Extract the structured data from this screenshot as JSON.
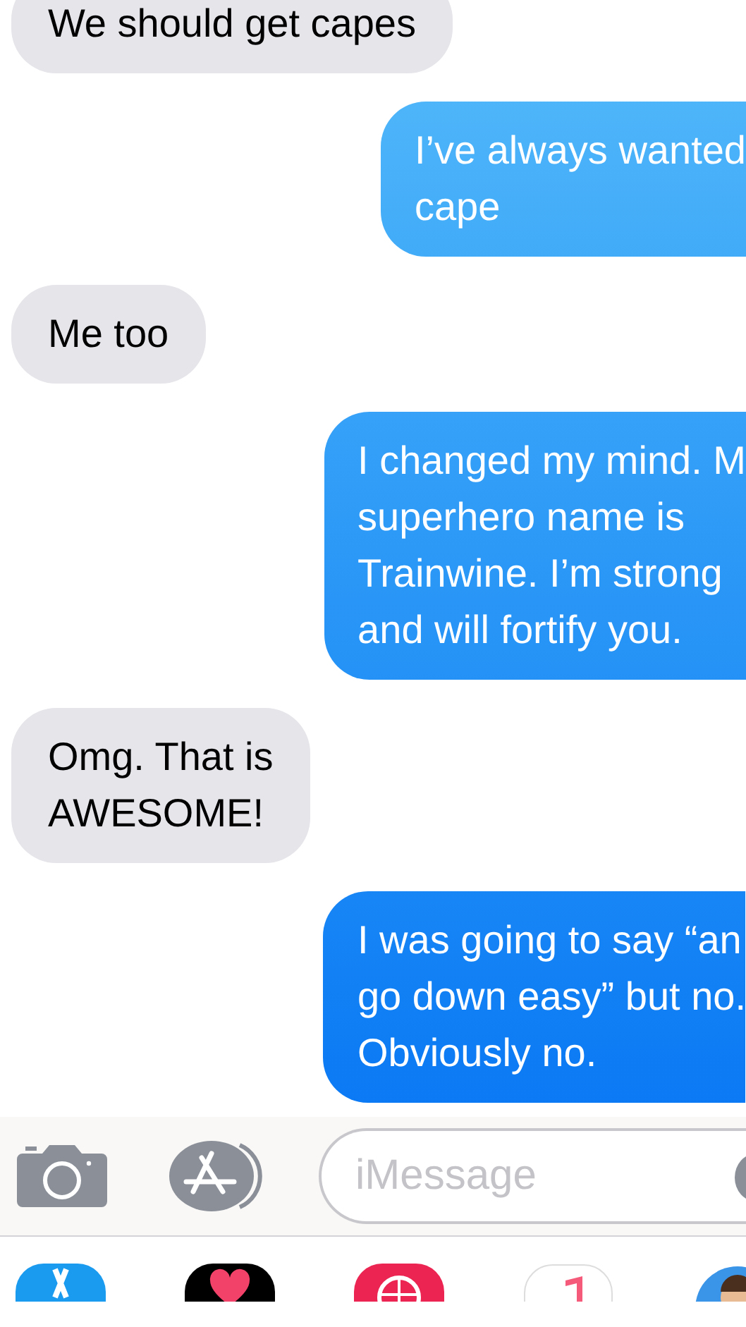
{
  "messages": [
    {
      "sent": false,
      "text": "We should get capes"
    },
    {
      "sent": true,
      "text": "I’ve always wanted\ncape"
    },
    {
      "sent": false,
      "text": "Me too"
    },
    {
      "sent": true,
      "text": "I changed my mind. M\nsuperhero name is\nTrainwine. I’m strong\nand will fortify you."
    },
    {
      "sent": false,
      "text": "Omg. That is\nAWESOME!"
    },
    {
      "sent": true,
      "text": "I was going to say “an\ngo down easy” but no.\nObviously no."
    }
  ],
  "compose_bar": {
    "placeholder": "iMessage"
  }
}
